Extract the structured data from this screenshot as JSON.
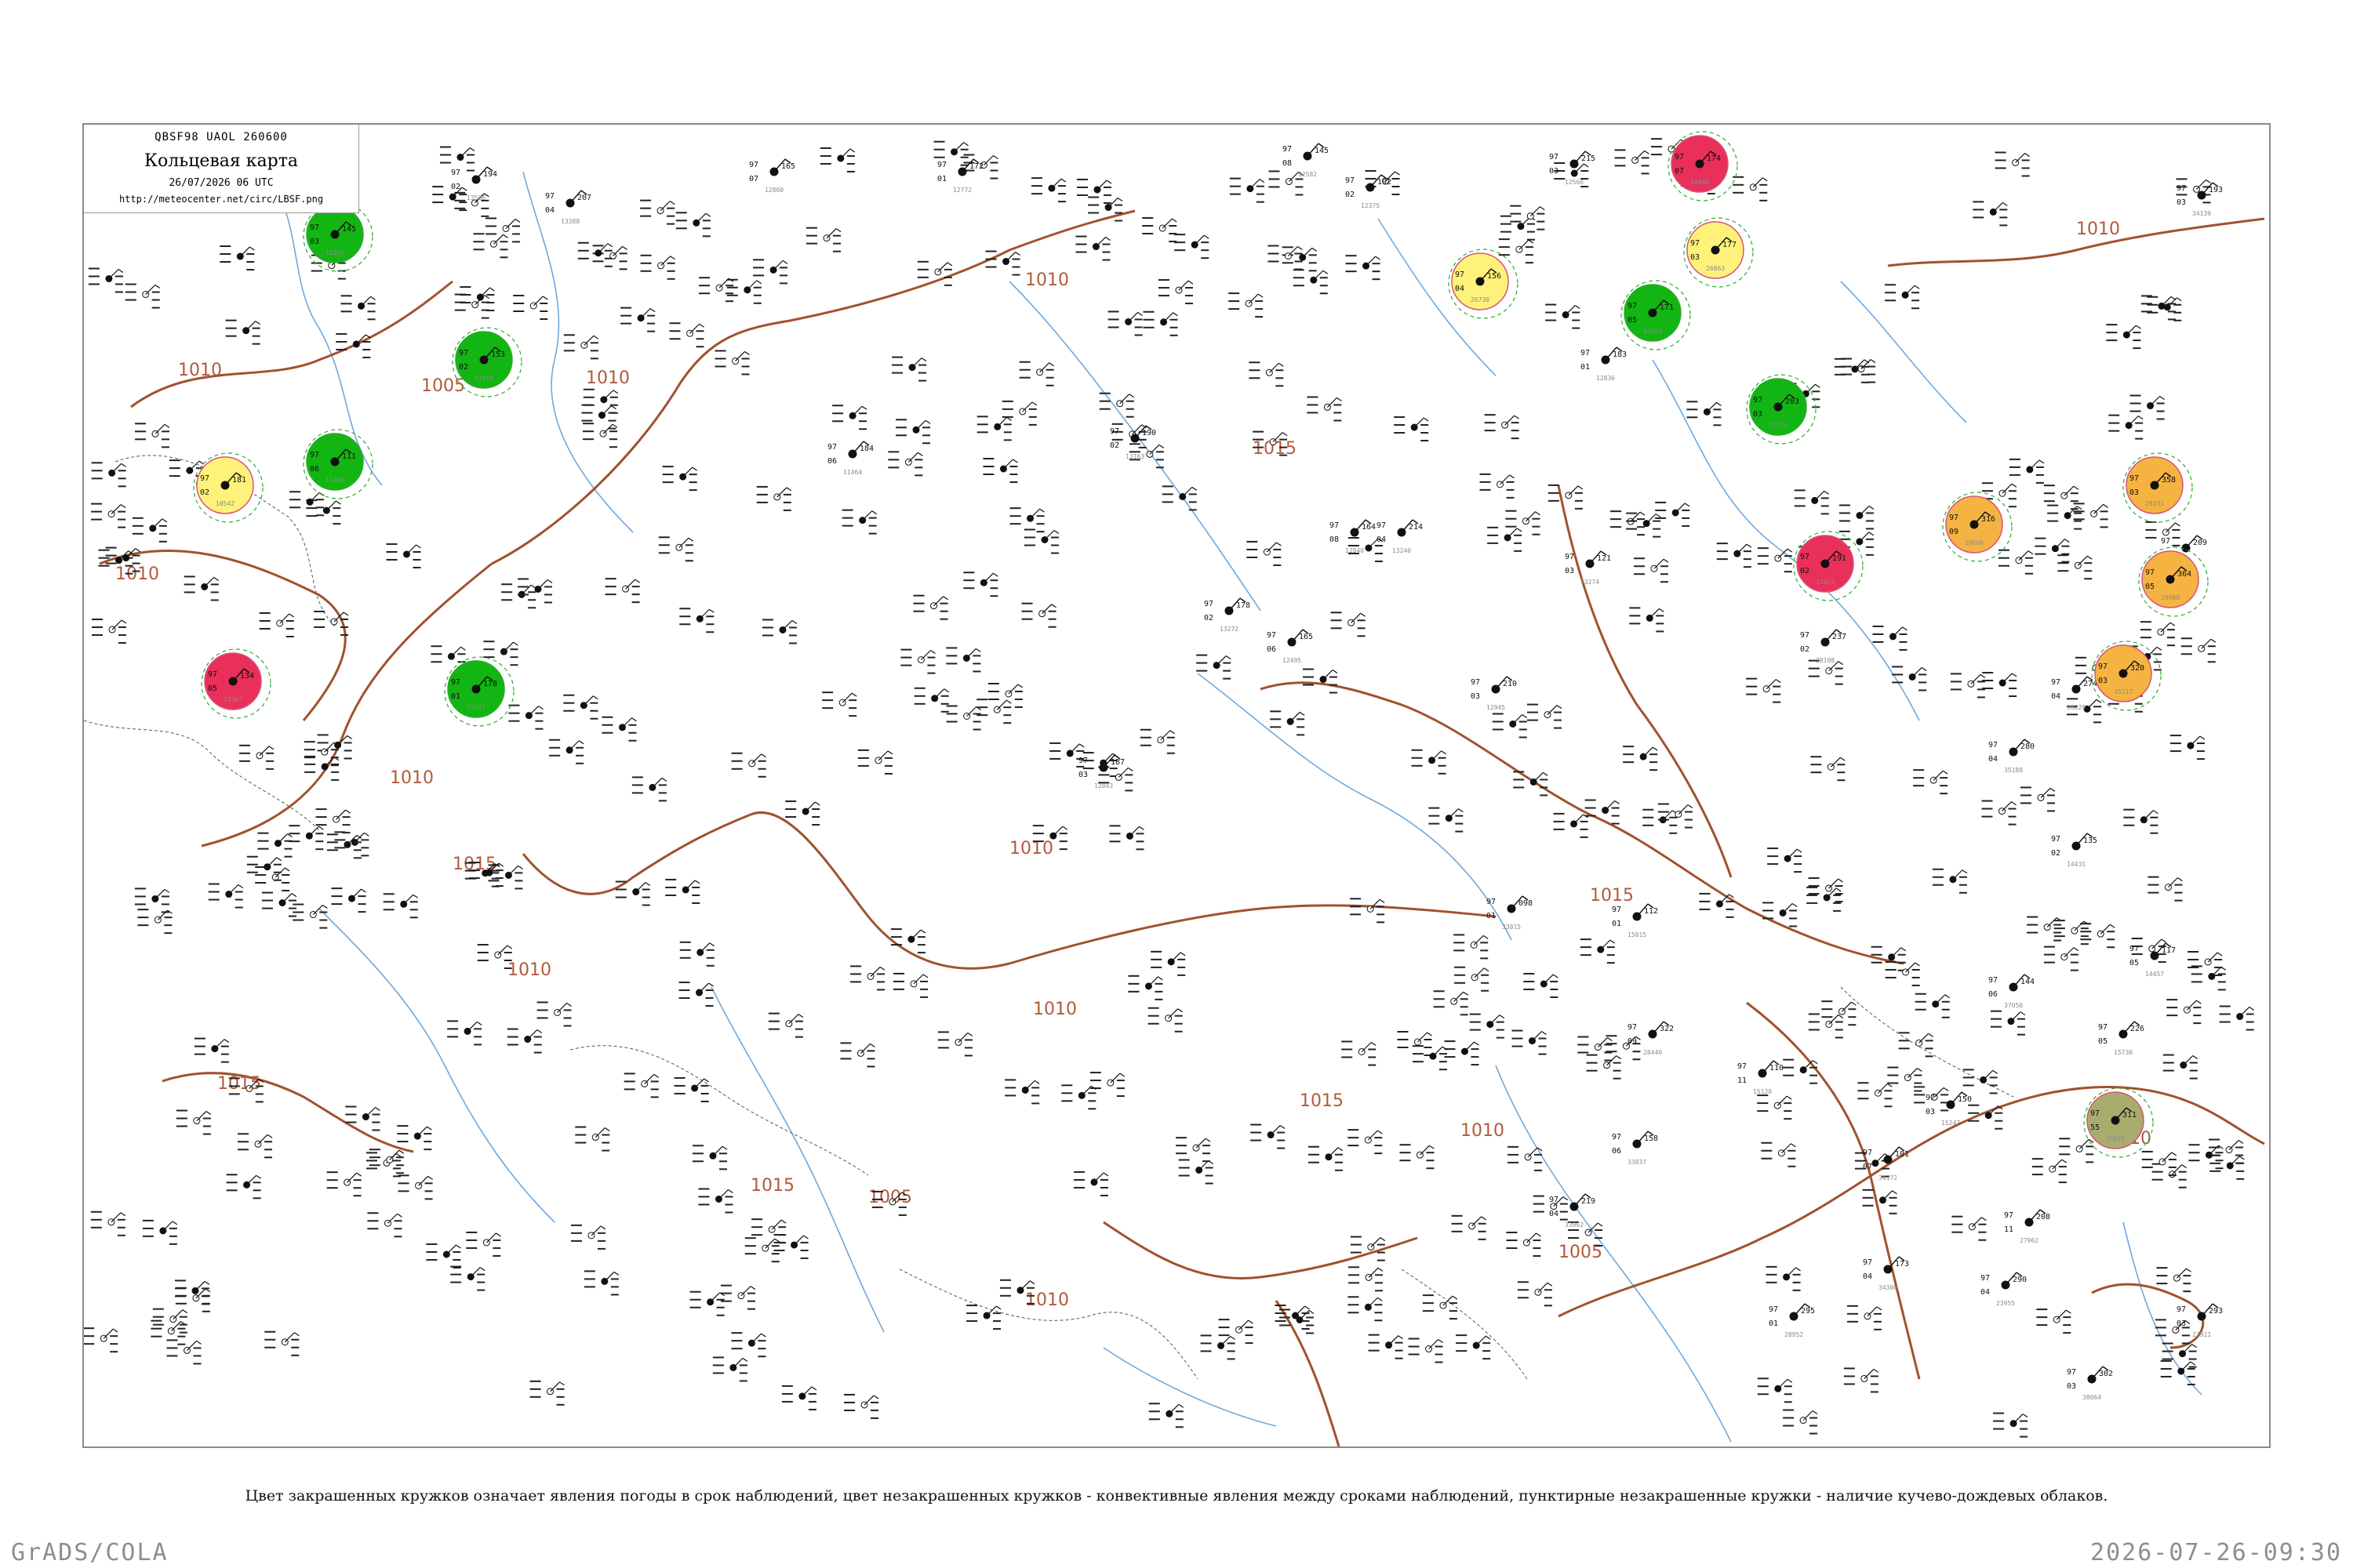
{
  "header": {
    "bulletin_code": "QBSF98  UAOL  260600",
    "title": "Кольцевая карта",
    "datetime": "26/07/2026 06 UTC",
    "url": "http://meteocenter.net/circ/LBSF.png"
  },
  "legend_note": "Цвет закрашенных кружков означает явления погоды в срок наблюдений, цвет незакрашенных кружков - конвективные явления между сроками наблюдений, пунктирные незакрашенные кружки - наличие кучево-дождевых облаков.",
  "footer": {
    "left": "GrADS/COLA",
    "right": "2026-07-26-09:30"
  },
  "colors": {
    "isobar": "#a0522d",
    "river": "#6fa8dc",
    "green": "#13b513",
    "red": "#e8305a",
    "yellow": "#fff27a",
    "orange": "#f5b342",
    "olive": "#a8ad6e",
    "dashed_green": "#2eaa2e",
    "pink_ring": "#d6557a"
  },
  "isobar_labels": [
    "1010",
    "1010",
    "1010",
    "1005",
    "1010",
    "1010",
    "1015",
    "1015",
    "1010",
    "1015",
    "1010",
    "1015",
    "1010",
    "1010",
    "1005",
    "1015",
    "1010",
    "1015",
    "1010",
    "1005",
    "1010"
  ],
  "stations": [
    {
      "pressure": "194",
      "temp": "97",
      "dew": "02",
      "id": "13586",
      "event": "none"
    },
    {
      "pressure": "207",
      "temp": "97",
      "dew": "04",
      "id": "13388",
      "event": "none"
    },
    {
      "pressure": "165",
      "temp": "97",
      "dew": "07",
      "id": "12860",
      "event": "none"
    },
    {
      "pressure": "172",
      "temp": "97",
      "dew": "01",
      "id": "12772",
      "event": "none"
    },
    {
      "pressure": "145",
      "temp": "97",
      "dew": "08",
      "id": "12582",
      "event": "none"
    },
    {
      "pressure": "192",
      "temp": "97",
      "dew": "02",
      "id": "12375",
      "event": "none"
    },
    {
      "pressure": "215",
      "temp": "97",
      "dew": "03",
      "id": "12566",
      "event": "none"
    },
    {
      "pressure": "183",
      "temp": "97",
      "dew": "01",
      "id": "12836",
      "event": "none"
    },
    {
      "pressure": "164",
      "temp": "97",
      "dew": "08",
      "id": "12840",
      "event": "none"
    },
    {
      "pressure": "121",
      "temp": "97",
      "dew": "03",
      "id": "13274",
      "event": "none"
    },
    {
      "pressure": "184",
      "temp": "97",
      "dew": "06",
      "id": "11464",
      "event": "none"
    },
    {
      "pressure": "190",
      "temp": "97",
      "dew": "02",
      "id": "13163",
      "event": "none"
    },
    {
      "pressure": "178",
      "temp": "97",
      "dew": "02",
      "id": "13272",
      "event": "none"
    },
    {
      "pressure": "214",
      "temp": "97",
      "dew": "04",
      "id": "13240",
      "event": "none"
    },
    {
      "pressure": "210",
      "temp": "97",
      "dew": "03",
      "id": "12945",
      "event": "none"
    },
    {
      "pressure": "112",
      "temp": "97",
      "dew": "01",
      "id": "15015",
      "event": "none"
    },
    {
      "pressure": "117",
      "temp": "97",
      "dew": "05",
      "id": "14457",
      "event": "none"
    },
    {
      "pressure": "187",
      "temp": "97",
      "dew": "03",
      "id": "12843",
      "event": "none"
    },
    {
      "pressure": "110",
      "temp": "97",
      "dew": "11",
      "id": "15120",
      "event": "none"
    },
    {
      "pressure": "150",
      "temp": "97",
      "dew": "03",
      "id": "15247",
      "event": "none"
    },
    {
      "pressure": "226",
      "temp": "97",
      "dew": "05",
      "id": "15730",
      "event": "none"
    },
    {
      "pressure": "135",
      "temp": "97",
      "dew": "02",
      "id": "14431",
      "event": "none"
    },
    {
      "pressure": "165",
      "temp": "97",
      "dew": "06",
      "id": "12495",
      "event": "none"
    },
    {
      "pressure": "098",
      "temp": "97",
      "dew": "01",
      "id": "33815",
      "event": "none"
    },
    {
      "pressure": "158",
      "temp": "97",
      "dew": "06",
      "id": "33837",
      "event": "none"
    },
    {
      "pressure": "101",
      "temp": "97",
      "dew": "07",
      "id": "34172",
      "event": "none"
    },
    {
      "pressure": "219",
      "temp": "97",
      "dew": "04",
      "id": "33962",
      "event": "none"
    },
    {
      "pressure": "144",
      "temp": "97",
      "dew": "06",
      "id": "37050",
      "event": "none"
    },
    {
      "pressure": "193",
      "temp": "97",
      "dew": "03",
      "id": "34139",
      "event": "none"
    },
    {
      "pressure": "173",
      "temp": "97",
      "dew": "04",
      "id": "34300",
      "event": "none"
    },
    {
      "pressure": "208",
      "temp": "97",
      "dew": "11",
      "id": "27962",
      "event": "none"
    },
    {
      "pressure": "237",
      "temp": "97",
      "dew": "02",
      "id": "28198",
      "event": "none"
    },
    {
      "pressure": "209",
      "temp": "97",
      "dew": "04",
      "id": "28138",
      "event": "none"
    },
    {
      "pressure": "322",
      "temp": "97",
      "dew": "09",
      "id": "28440",
      "event": "none"
    },
    {
      "pressure": "274",
      "temp": "97",
      "dew": "04",
      "id": "35229",
      "event": "none"
    },
    {
      "pressure": "280",
      "temp": "97",
      "dew": "04",
      "id": "35188",
      "event": "none"
    },
    {
      "pressure": "295",
      "temp": "97",
      "dew": "01",
      "id": "28952",
      "event": "none"
    },
    {
      "pressure": "302",
      "temp": "97",
      "dew": "03",
      "id": "38064",
      "event": "none"
    },
    {
      "pressure": "290",
      "temp": "97",
      "dew": "04",
      "id": "23955",
      "event": "none"
    },
    {
      "pressure": "293",
      "temp": "97",
      "dew": "03",
      "id": "23921",
      "event": "none"
    },
    {
      "pressure": "134",
      "temp": "97",
      "dew": "05",
      "id": "14307",
      "event": "red"
    },
    {
      "pressure": "174",
      "temp": "97",
      "dew": "07",
      "id": "10948",
      "event": "red"
    },
    {
      "pressure": "191",
      "temp": "97",
      "dew": "02",
      "id": "27453",
      "event": "red"
    },
    {
      "pressure": "145",
      "temp": "97",
      "dew": "03",
      "id": "12205",
      "event": "green"
    },
    {
      "pressure": "111",
      "temp": "97",
      "dew": "06",
      "id": "11406",
      "event": "green"
    },
    {
      "pressure": "153",
      "temp": "97",
      "dew": "02",
      "id": "11518",
      "event": "green"
    },
    {
      "pressure": "178",
      "temp": "97",
      "dew": "01",
      "id": "33317",
      "event": "green"
    },
    {
      "pressure": "171",
      "temp": "97",
      "dew": "05",
      "id": "34163",
      "event": "green"
    },
    {
      "pressure": "203",
      "temp": "97",
      "dew": "03",
      "id": "27731",
      "event": "green"
    },
    {
      "pressure": "181",
      "temp": "97",
      "dew": "02",
      "id": "10542",
      "event": "yellow"
    },
    {
      "pressure": "177",
      "temp": "97",
      "dew": "03",
      "id": "26863",
      "event": "yellow"
    },
    {
      "pressure": "156",
      "temp": "97",
      "dew": "04",
      "id": "26730",
      "event": "yellow"
    },
    {
      "pressure": "316",
      "temp": "97",
      "dew": "09",
      "id": "28666",
      "event": "orange"
    },
    {
      "pressure": "358",
      "temp": "97",
      "dew": "03",
      "id": "29231",
      "event": "orange"
    },
    {
      "pressure": "320",
      "temp": "97",
      "dew": "03",
      "id": "35217",
      "event": "orange"
    },
    {
      "pressure": "364",
      "temp": "97",
      "dew": "05",
      "id": "28900",
      "event": "orange"
    },
    {
      "pressure": "311",
      "temp": "97",
      "dew": "55",
      "id": "35671",
      "event": "olive"
    }
  ]
}
